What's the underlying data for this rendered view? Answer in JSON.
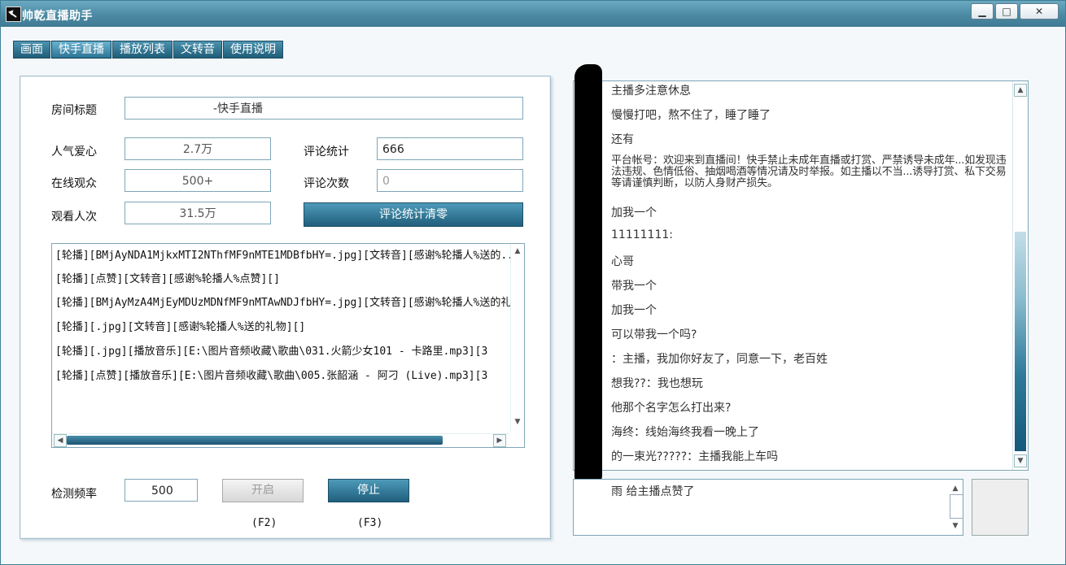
{
  "window": {
    "title": "帅乾直播助手",
    "minimize": "▁",
    "maximize": "□",
    "close": "✕"
  },
  "tabs": [
    "画面",
    "快手直播",
    "播放列表",
    "文转音",
    "使用说明"
  ],
  "active_tab": "快手直播",
  "room": {
    "title_label": "房间标题",
    "title_value": "-快手直播",
    "popularity_label": "人气爱心",
    "popularity_value": "2.7万",
    "comment_stat_label": "评论统计",
    "comment_stat_value": "666",
    "online_label": "在线观众",
    "online_value": "500+",
    "comment_count_label": "评论次数",
    "comment_count_value": "0",
    "views_label": "观看人次",
    "views_value": "31.5万",
    "reset_button": "评论统计清零"
  },
  "rotation_list": [
    "[轮播][BMjAyNDA1MjkxMTI2NThfMF9nMTE1MDBfbHY=.jpg][文转音][感谢%轮播人%送的...",
    "[轮播][点赞][文转音][感谢%轮播人%点赞][]",
    "[轮播][BMjAyMzA4MjEyMDUzMDNfMF9nMTAwNDJfbHY=.jpg][文转音][感谢%轮播人%送的礼",
    "[轮播][.jpg][文转音][感谢%轮播人%送的礼物][]",
    "[轮播][.jpg][播放音乐][E:\\图片音频收藏\\歌曲\\031.火箭少女101 - 卡路里.mp3][3",
    "[轮播][点赞][播放音乐][E:\\图片音频收藏\\歌曲\\005.张韶涵 - 阿刁 (Live).mp3][3"
  ],
  "controls": {
    "frequency_label": "检测频率",
    "frequency_value": "500",
    "start_button": "开启",
    "stop_button": "停止",
    "start_hotkey": "(F2)",
    "stop_hotkey": "(F3)"
  },
  "chat_messages": [
    "主播多注意休息",
    "慢慢打吧，熬不住了，睡了睡了",
    "还有",
    "平台帐号：欢迎来到直播间！快手禁止未成年直播或打赏、严禁诱导未成年...如发现违法违规、色情低俗、抽烟喝酒等情况请及时举报。如主播以不当...诱导打赏、私下交易等请谨慎判断，以防人身财产损失。",
    "加我一个",
    "11111111:",
    "心哥",
    "带我一个",
    "加我一个",
    "可以带我一个吗?",
    "：主播，我加你好友了，同意一下，老百姓",
    "想我??：我也想玩",
    "他那个名字怎么打出来?",
    "海终：线始海终我看一晚上了",
    "的一束光?????：主播我能上车吗"
  ],
  "gift_message": "雨 给主播点赞了"
}
